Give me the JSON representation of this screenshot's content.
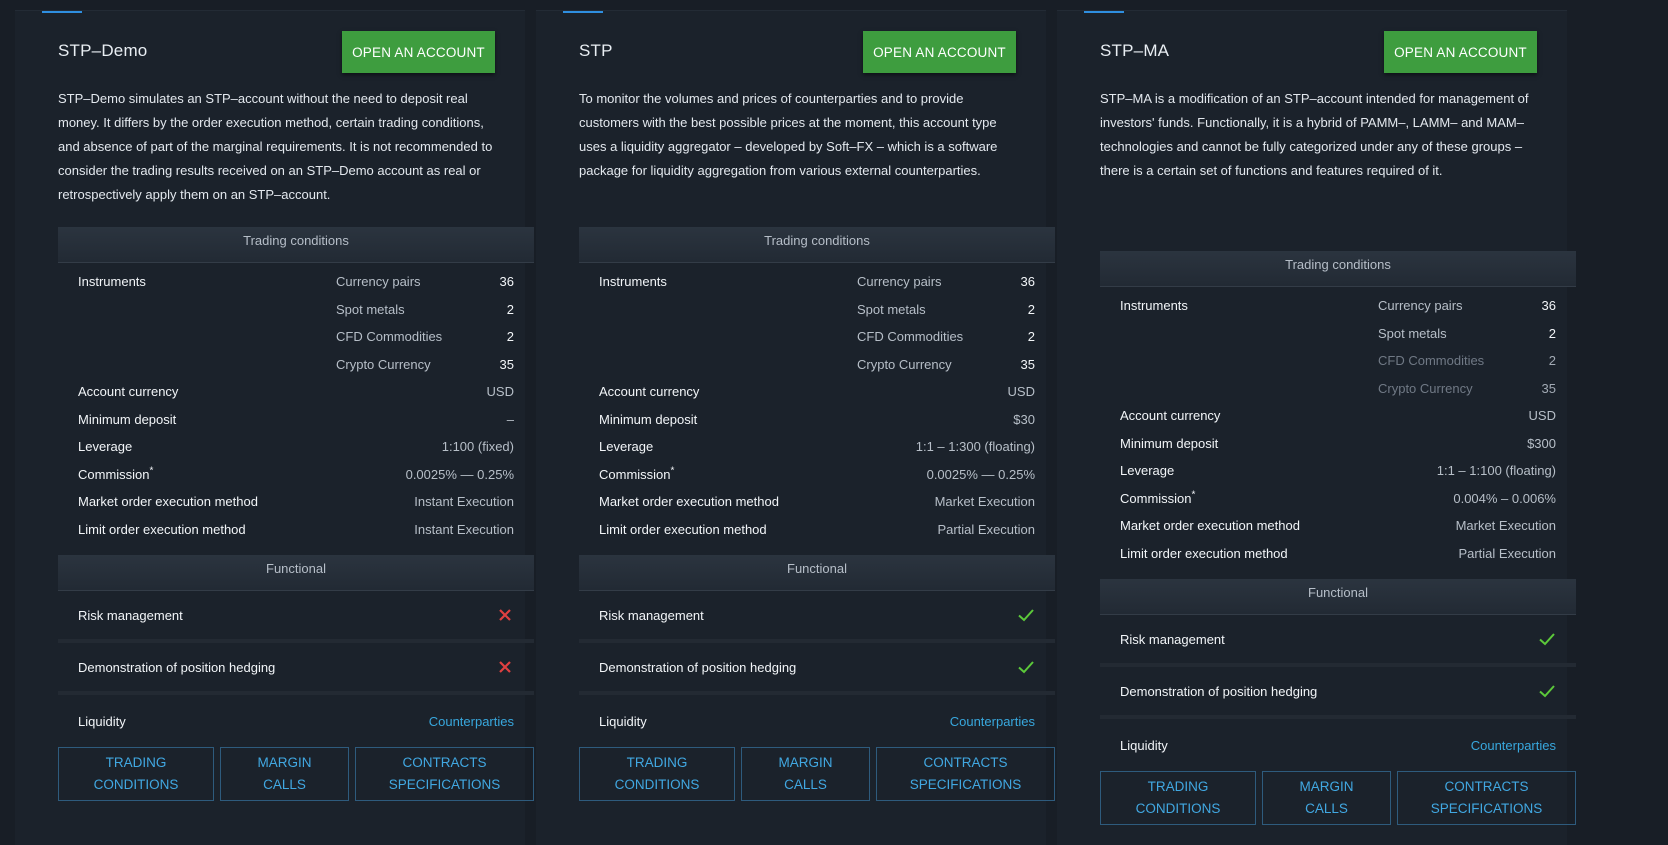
{
  "cards": [
    {
      "title": "STP–Demo",
      "open_label": "OPEN AN ACCOUNT",
      "description": "STP–Demo simulates an STP–account without the need to deposit real money. It differs by the order execution method, certain trading conditions, and absence of part of the marginal requirements. It is not recommended to consider the trading results received on an STP–Demo account as real or retrospectively apply them on an STP–account.",
      "trading_header": "Trading conditions",
      "instruments_label": "Instruments",
      "instruments": [
        {
          "name": "Currency pairs",
          "count": "36"
        },
        {
          "name": "Spot metals",
          "count": "2"
        },
        {
          "name": "CFD Commodities",
          "count": "2"
        },
        {
          "name": "Crypto Currency",
          "count": "35"
        }
      ],
      "conditions": [
        {
          "label": "Account currency",
          "value": "USD"
        },
        {
          "label": "Minimum deposit",
          "value": "–"
        },
        {
          "label": "Leverage",
          "value": "1:100 (fixed)"
        },
        {
          "label": "Commission",
          "value": "0.0025% — 0.25%"
        },
        {
          "label": "Market order execution method",
          "value": "Instant Execution"
        },
        {
          "label": "Limit order execution method",
          "value": "Instant Execution"
        }
      ],
      "functional_header": "Functional",
      "functional": [
        {
          "label": "Risk management",
          "status": "cross"
        },
        {
          "label": "Demonstration of position hedging",
          "status": "cross"
        }
      ],
      "liquidity_label": "Liquidity",
      "liquidity_link": "Counterparties",
      "buttons": {
        "trading_1": "TRADING",
        "trading_2": "CONDITIONS",
        "margin_1": "MARGIN",
        "margin_2": "CALLS",
        "contracts_1": "CONTRACTS",
        "contracts_2": "SPECIFICATIONS"
      }
    },
    {
      "title": "STP",
      "open_label": "OPEN AN ACCOUNT",
      "description": "To monitor the volumes and prices of counterparties and to provide customers with the best possible prices at the moment, this account type uses a liquidity aggregator – developed by Soft–FX – which is a software package for liquidity aggregation from various external counterparties.",
      "trading_header": "Trading conditions",
      "instruments_label": "Instruments",
      "instruments": [
        {
          "name": "Currency pairs",
          "count": "36"
        },
        {
          "name": "Spot metals",
          "count": "2"
        },
        {
          "name": "CFD Commodities",
          "count": "2"
        },
        {
          "name": "Crypto Currency",
          "count": "35"
        }
      ],
      "conditions": [
        {
          "label": "Account currency",
          "value": "USD"
        },
        {
          "label": "Minimum deposit",
          "value": "$30"
        },
        {
          "label": "Leverage",
          "value": "1:1 – 1:300 (floating)"
        },
        {
          "label": "Commission",
          "value": "0.0025% — 0.25%"
        },
        {
          "label": "Market order execution method",
          "value": "Market Execution"
        },
        {
          "label": "Limit order execution method",
          "value": "Partial Execution"
        }
      ],
      "functional_header": "Functional",
      "functional": [
        {
          "label": "Risk management",
          "status": "check"
        },
        {
          "label": "Demonstration of position hedging",
          "status": "check"
        }
      ],
      "liquidity_label": "Liquidity",
      "liquidity_link": "Counterparties",
      "buttons": {
        "trading_1": "TRADING",
        "trading_2": "CONDITIONS",
        "margin_1": "MARGIN",
        "margin_2": "CALLS",
        "contracts_1": "CONTRACTS",
        "contracts_2": "SPECIFICATIONS"
      }
    },
    {
      "title": "STP–MA",
      "open_label": "OPEN AN ACCOUNT",
      "description": "STP–MA is a modification of an STP–account intended for management of investors' funds. Functionally, it is a hybrid of PAMM–, LAMM– and MAM–technologies and cannot be fully categorized under any of these groups – there is a certain set of functions and features required of it.",
      "trading_header": "Trading conditions",
      "instruments_label": "Instruments",
      "instruments": [
        {
          "name": "Currency pairs",
          "count": "36"
        },
        {
          "name": "Spot metals",
          "count": "2"
        },
        {
          "name": "CFD Commodities",
          "count": "2"
        },
        {
          "name": "Crypto Currency",
          "count": "35"
        }
      ],
      "conditions": [
        {
          "label": "Account currency",
          "value": "USD"
        },
        {
          "label": "Minimum deposit",
          "value": "$300"
        },
        {
          "label": "Leverage",
          "value": "1:1 – 1:100 (floating)"
        },
        {
          "label": "Commission",
          "value": "0.004% – 0.006%"
        },
        {
          "label": "Market order execution method",
          "value": "Market Execution"
        },
        {
          "label": "Limit order execution method",
          "value": "Partial Execution"
        }
      ],
      "functional_header": "Functional",
      "functional": [
        {
          "label": "Risk management",
          "status": "check"
        },
        {
          "label": "Demonstration of position hedging",
          "status": "check"
        }
      ],
      "liquidity_label": "Liquidity",
      "liquidity_link": "Counterparties",
      "buttons": {
        "trading_1": "TRADING",
        "trading_2": "CONDITIONS",
        "margin_1": "MARGIN",
        "margin_2": "CALLS",
        "contracts_1": "CONTRACTS",
        "contracts_2": "SPECIFICATIONS"
      }
    }
  ],
  "colors": {
    "background": "#181e26",
    "card": "#1b222b",
    "accent_green": "#3e9d3f",
    "link_blue": "#38a8de",
    "check_green": "#5cc93a",
    "cross_red": "#e04040"
  },
  "commission_marker": "*"
}
